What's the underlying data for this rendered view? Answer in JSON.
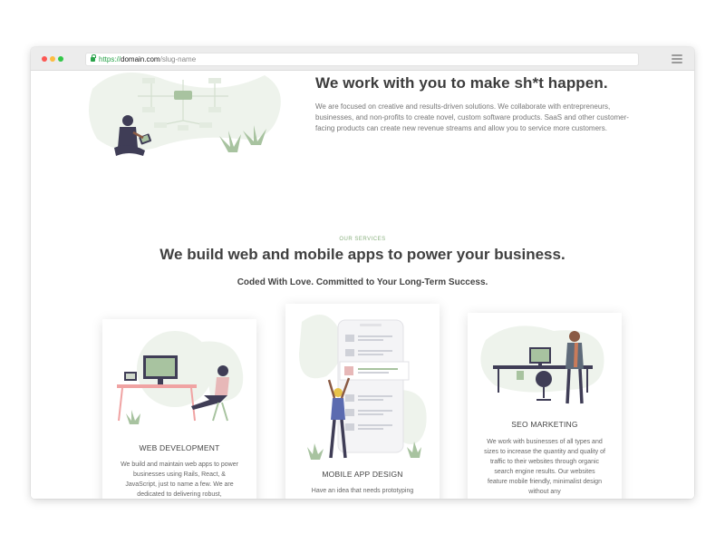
{
  "browser": {
    "url_https": "https://",
    "url_domain": "domain.com",
    "url_path": "/slug-name"
  },
  "hero": {
    "title": "We work with you to make sh*t happen.",
    "text": "We are focused on creative and results-driven solutions. We collaborate with entrepreneurs, businesses, and non-profits to create novel, custom software products. SaaS and other customer-facing products can create new revenue streams and allow you to service more customers."
  },
  "services": {
    "kicker": "OUR SERVICES",
    "title": "We build web and mobile apps to power your business.",
    "subtitle": "Coded With Love. Committed to Your Long-Term Success.",
    "cards": [
      {
        "title": "WEB DEVELOPMENT",
        "text": "We build and maintain web apps to power businesses using Rails, React, & JavaScript, just to name a few. We are dedicated to delivering robust,"
      },
      {
        "title": "MOBILE APP DESIGN",
        "text": "Have an idea that needs prototyping"
      },
      {
        "title": "SEO MARKETING",
        "text": "We work with businesses of all types and sizes to increase the quantity and quality of traffic to their websites through organic search engine results. Our websites feature mobile friendly, minimalist design without any"
      }
    ]
  },
  "colors": {
    "accent_green": "#8ab07f",
    "heading": "#3c3c3c",
    "body_text": "#777777",
    "figure_purple": "#3f3d56",
    "plant_green": "#a8c3a0"
  }
}
